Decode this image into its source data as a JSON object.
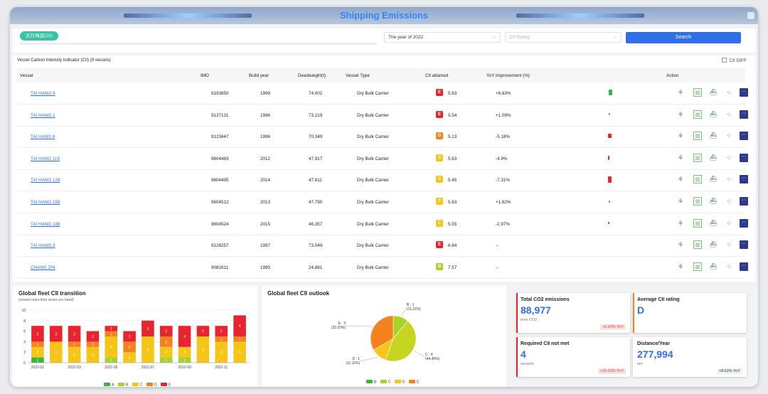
{
  "app": {
    "title": "Shipping Emissions"
  },
  "filters": {
    "tag_label": "太行海运(10)",
    "year_value": "The year of 2022",
    "cii_placeholder": "CII Rating",
    "search_label": "Search"
  },
  "table": {
    "title": "Vessel Carbon Intensity Indicator (CII) (9 vessels)",
    "cii_diff_label": "CII DIFF",
    "headers": {
      "vessel": "Vessel",
      "imo": "IMO",
      "build_year": "Build year",
      "deadweight": "Deadweight(t)",
      "vessel_type": "Vessel Type",
      "cii": "CII attained",
      "yoy": "YoY improvement (%)",
      "action": "Action"
    },
    "rows": [
      {
        "vessel": "TAI HANG 9",
        "imo": "9193850",
        "build_year": "1999",
        "deadweight": "74,002",
        "type": "Dry Bulk Carrier",
        "rating": "E",
        "cii": "5.63",
        "yoy": "+6.83%",
        "yoy_value": 6.83
      },
      {
        "vessel": "TAI HANG 1",
        "imo": "9137131",
        "build_year": "1996",
        "deadweight": "73,219",
        "type": "Dry Bulk Carrier",
        "rating": "E",
        "cii": "5.54",
        "yoy": "+1.09%",
        "yoy_value": 1.09
      },
      {
        "vessel": "TAI HANG 6",
        "imo": "9123647",
        "build_year": "1996",
        "deadweight": "70,349",
        "type": "Dry Bulk Carrier",
        "rating": "D",
        "cii": "5.13",
        "yoy": "-5.18%",
        "yoy_value": -5.18
      },
      {
        "vessel": "TAI HANG 118",
        "imo": "9604483",
        "build_year": "2012",
        "deadweight": "47,917",
        "type": "Dry Bulk Carrier",
        "rating": "C",
        "cii": "5.63",
        "yoy": "-4.9%",
        "yoy_value": -4.9
      },
      {
        "vessel": "TAI HANG 128",
        "imo": "9604495",
        "build_year": "2014",
        "deadweight": "47,811",
        "type": "Dry Bulk Carrier",
        "rating": "C",
        "cii": "5.45",
        "yoy": "-7.31%",
        "yoy_value": -7.31
      },
      {
        "vessel": "TAI HANG 158",
        "imo": "9604512",
        "build_year": "2013",
        "deadweight": "47,790",
        "type": "Dry Bulk Carrier",
        "rating": "C",
        "cii": "5.63",
        "yoy": "+1.62%",
        "yoy_value": 1.62
      },
      {
        "vessel": "TAI HANG 188",
        "imo": "9604524",
        "build_year": "2015",
        "deadweight": "46,357",
        "type": "Dry Bulk Carrier",
        "rating": "C",
        "cii": "5.55",
        "yoy": "-2.97%",
        "yoy_value": -2.97
      },
      {
        "vessel": "TAI HANG 3",
        "imo": "9128257",
        "build_year": "1997",
        "deadweight": "73,049",
        "type": "Dry Bulk Carrier",
        "rating": "E",
        "cii": "6.84",
        "yoy": "--",
        "yoy_value": null
      },
      {
        "vessel": "CHANG ZHI",
        "imo": "9082611",
        "build_year": "1995",
        "deadweight": "24,881",
        "type": "Dry Bulk Carrier",
        "rating": "B",
        "cii": "7.57",
        "yoy": "--",
        "yoy_value": null
      }
    ],
    "rating_colors": {
      "A": "#3db33d",
      "B": "#a6d22a",
      "C": "#f5c518",
      "D": "#f5821f",
      "E": "#e8242f"
    },
    "yoy_colors": {
      "positive": "#2eb85c",
      "negative": "#e8242f"
    },
    "action_icons": [
      "footprint-icon",
      "report-icon",
      "ship-icon",
      "dots-icon",
      "more-icon"
    ]
  },
  "transition": {
    "title": "Global fleet CII transition",
    "subtitle": "(vessel count time series per band)",
    "chart_data": {
      "type": "bar",
      "stacked": true,
      "categories": [
        "2022-01",
        "2022-02",
        "2022-03",
        "2022-04",
        "2022-05",
        "2022-06",
        "2022-07",
        "2022-08",
        "2022-09",
        "2022-10",
        "2022-11",
        "2022-12"
      ],
      "x_tick_labels": [
        "2022-01",
        "",
        "2022-03",
        "",
        "2022-05",
        "",
        "2022-07",
        "",
        "2022-09",
        "",
        "2022-11",
        ""
      ],
      "ylim": [
        0,
        10
      ],
      "yticks": [
        0,
        2,
        4,
        6,
        8,
        10
      ],
      "grid": true,
      "legend": "bottom",
      "series": [
        {
          "name": "A",
          "color": "#3db33d",
          "values": [
            1,
            0,
            0,
            0,
            0,
            0,
            0,
            0,
            0,
            0,
            0,
            0
          ]
        },
        {
          "name": "B",
          "color": "#a6d22a",
          "values": [
            0,
            0,
            0,
            0,
            1,
            0,
            0,
            1,
            1,
            0,
            0,
            0
          ]
        },
        {
          "name": "C",
          "color": "#f5c518",
          "values": [
            2,
            4,
            3,
            3,
            4,
            2,
            5,
            2,
            2,
            5,
            4,
            4
          ]
        },
        {
          "name": "D",
          "color": "#f5821f",
          "values": [
            1,
            0,
            1,
            1,
            1,
            2,
            0,
            2,
            0,
            0,
            1,
            1
          ]
        },
        {
          "name": "E",
          "color": "#e8242f",
          "values": [
            3,
            3,
            3,
            2,
            1,
            2,
            3,
            2,
            4,
            2,
            2,
            4
          ]
        }
      ]
    }
  },
  "outlook": {
    "title": "Global fleet CII outlook",
    "chart_data": {
      "type": "pie",
      "legend": "bottom",
      "slices": [
        {
          "name": "B",
          "value": 1,
          "percent": "11.11%",
          "label": "B : 1",
          "color": "#a6d22a"
        },
        {
          "name": "C",
          "value": 4,
          "percent": "44.45%",
          "label": "C : 4",
          "color": "#c6d620"
        },
        {
          "name": "D",
          "value": 1,
          "percent": "11.11%",
          "label": "D : 1",
          "color": "#f5c518"
        },
        {
          "name": "E",
          "value": 3,
          "percent": "33.33%",
          "label": "E : 3",
          "color": "#f5821f"
        }
      ],
      "legend_items": [
        {
          "name": "B",
          "color": "#3db33d"
        },
        {
          "name": "C",
          "color": "#a6d22a"
        },
        {
          "name": "D",
          "color": "#f5c518"
        },
        {
          "name": "E",
          "color": "#f5821f"
        }
      ]
    }
  },
  "kpis": {
    "co2": {
      "title": "Total CO2 emissions",
      "value": "88,977",
      "unit": "tons CO2",
      "change": "+5.29% YoY"
    },
    "avg": {
      "title": "Average CII rating",
      "value": "D"
    },
    "notmet": {
      "title": "Required CII not met",
      "value": "4",
      "unit": "vessels",
      "change": "+33.33% YoY"
    },
    "distance": {
      "title": "Distance/Year",
      "value": "277,994",
      "unit": "nm",
      "change": "+8.62% YoY"
    }
  }
}
